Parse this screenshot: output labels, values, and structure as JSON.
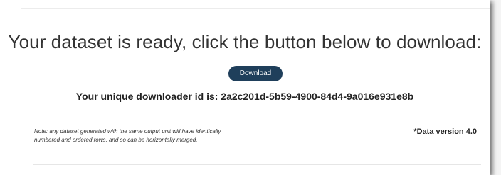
{
  "main": {
    "headline": "Your dataset is ready, click the button below to download:",
    "download_label": "Download",
    "id_prefix": "Your unique downloader id is: ",
    "downloader_id": "2a2c201d-5b59-4900-84d4-9a016e931e8b"
  },
  "footer": {
    "note": "Note: any dataset generated with the same output unit will have identically numbered and ordered rows, and so can be horizontally merged.",
    "data_version": "*Data version 4.0"
  },
  "colors": {
    "button_bg": "#1f3f5b",
    "button_text": "#ffffff",
    "text": "#333333"
  }
}
